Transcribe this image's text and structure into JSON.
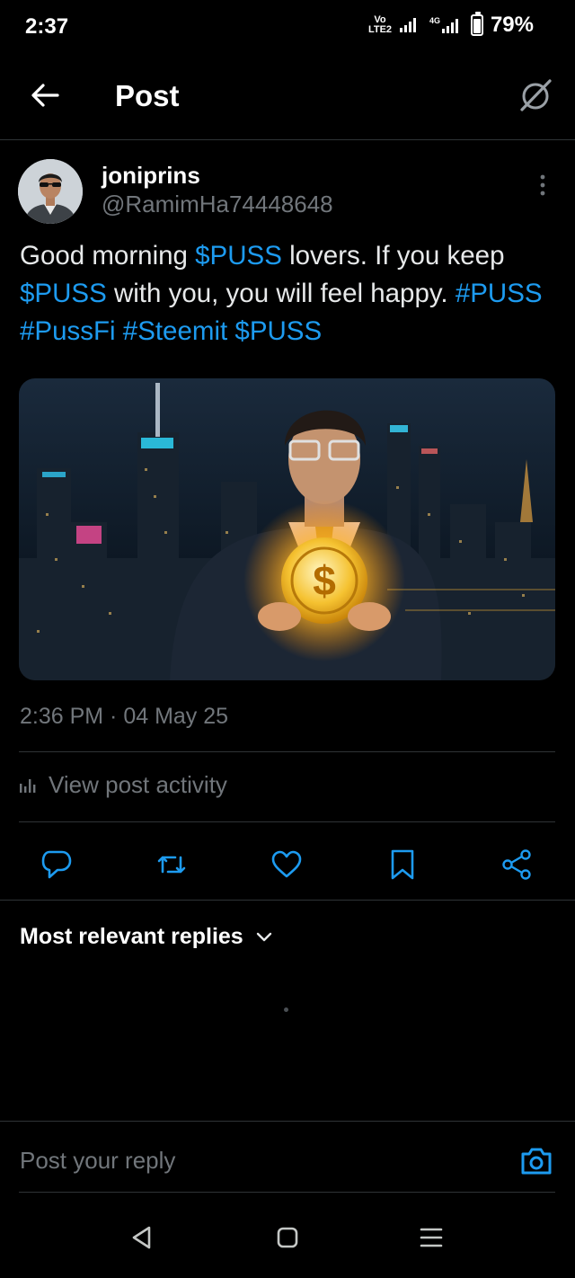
{
  "status_bar": {
    "time": "2:37",
    "volte": "Vo LTE2",
    "network": "4G",
    "battery": "79%"
  },
  "header": {
    "title": "Post"
  },
  "author": {
    "name": "joniprins",
    "handle": "@RamimHa74448648"
  },
  "post": {
    "text_segments": [
      {
        "text": "Good morning ",
        "kind": "text"
      },
      {
        "text": "$PUSS",
        "kind": "tag"
      },
      {
        "text": " lovers. If you keep ",
        "kind": "text"
      },
      {
        "text": "$PUSS",
        "kind": "tag"
      },
      {
        "text": " with you, you will feel happy. ",
        "kind": "text"
      },
      {
        "text": "#PUSS",
        "kind": "tag"
      },
      {
        "text": " ",
        "kind": "text"
      },
      {
        "text": "#PussFi",
        "kind": "tag"
      },
      {
        "text": " ",
        "kind": "text"
      },
      {
        "text": "#Steemit",
        "kind": "tag"
      },
      {
        "text": " ",
        "kind": "text"
      },
      {
        "text": "$PUSS",
        "kind": "tag"
      }
    ],
    "timestamp": "2:36 PM · 04 May 25",
    "activity_label": "View post activity"
  },
  "replies": {
    "sort_label": "Most relevant replies"
  },
  "reply_bar": {
    "placeholder": "Post your reply"
  },
  "colors": {
    "accent": "#1d9bf0",
    "muted": "#71767b",
    "divider": "#2f3336",
    "background": "#000000"
  },
  "icons": {
    "header": [
      "back-arrow-icon",
      "grok-icon"
    ],
    "actions": [
      "reply-icon",
      "repost-icon",
      "like-icon",
      "bookmark-icon",
      "share-icon"
    ],
    "nav": [
      "nav-back-icon",
      "nav-home-icon",
      "nav-recents-icon"
    ]
  }
}
